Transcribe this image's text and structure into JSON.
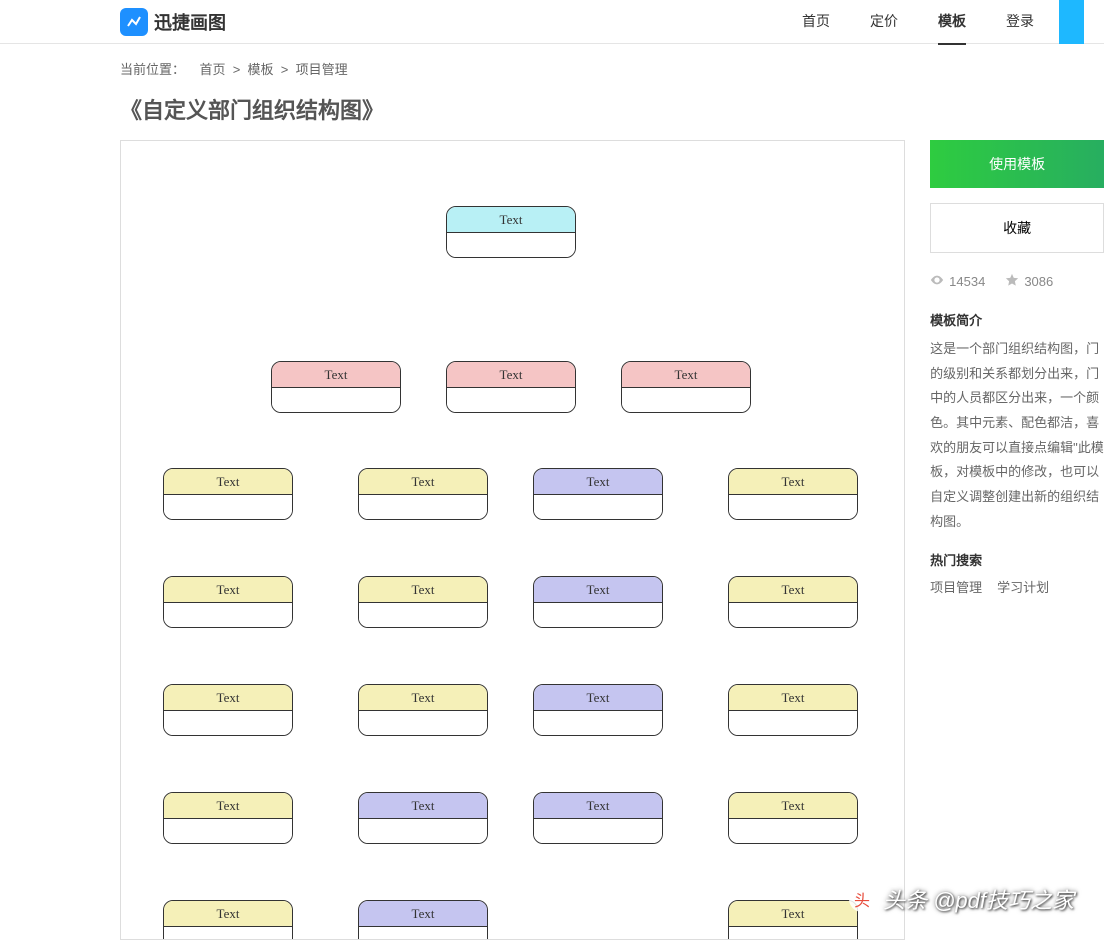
{
  "header": {
    "logo_text": "迅捷画图",
    "nav": {
      "home": "首页",
      "pricing": "定价",
      "templates": "模板",
      "login": "登录"
    }
  },
  "breadcrumb": {
    "label": "当前位置：",
    "home": "首页",
    "templates": "模板",
    "category": "项目管理"
  },
  "page_title": "《自定义部门组织结构图》",
  "diagram": {
    "root": "Text",
    "level2": [
      "Text",
      "Text",
      "Text"
    ],
    "rows": [
      [
        "Text",
        "Text",
        "Text",
        "Text"
      ],
      [
        "Text",
        "Text",
        "Text",
        "Text"
      ],
      [
        "Text",
        "Text",
        "Text",
        "Text"
      ],
      [
        "Text",
        "Text",
        "Text",
        "Text"
      ],
      [
        "Text",
        "Text",
        "",
        "Text"
      ]
    ]
  },
  "sidebar": {
    "use_template": "使用模板",
    "favorite": "收藏",
    "views": "14534",
    "stars": "3086",
    "intro_title": "模板简介",
    "intro_desc": "这是一个部门组织结构图，门的级别和关系都划分出来，门中的人员都区分出来，一个颜色。其中元素、配色都洁，喜欢的朋友可以直接点编辑\"此模板，对模板中的修改，也可以自定义调整创建出新的组织结构图。",
    "hot_title": "热门搜索",
    "hot_tags": [
      "项目管理",
      "学习计划"
    ]
  },
  "watermark": "头条 @pdf技巧之家"
}
